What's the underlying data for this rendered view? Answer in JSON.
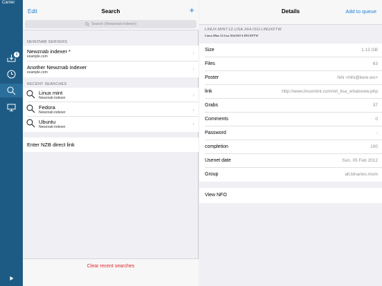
{
  "status_bar": {
    "carrier": "Carrier"
  },
  "sidebar": {
    "download_badge": "1",
    "items": [
      {
        "icon": "download-icon"
      },
      {
        "icon": "clock-icon"
      },
      {
        "icon": "search-icon"
      },
      {
        "icon": "monitor-icon"
      },
      {
        "icon": "play-icon"
      }
    ]
  },
  "middle": {
    "edit_label": "Edit",
    "title": "Search",
    "add_label": "+",
    "search_placeholder": "Search (Newznab indexer)",
    "servers_header": "NEWZNAB SERVERS",
    "servers": [
      {
        "name": "Newznab indexer *",
        "host": "example.com"
      },
      {
        "name": "Another Newznab indexer",
        "host": "example.com"
      }
    ],
    "recent_header": "RECENT SEARCHES",
    "recent": [
      {
        "query": "Linux mint",
        "indexer": "Newznab indexer"
      },
      {
        "query": "Fedora",
        "indexer": "Newznab indexer"
      },
      {
        "query": "Ubuntu",
        "indexer": "Newznab indexer"
      }
    ],
    "direct_link_label": "Enter NZB direct link",
    "clear_label": "Clear recent searches"
  },
  "details": {
    "title": "Details",
    "add_to_queue": "Add to queue",
    "filename": "LINUX.MINT.12.LISA.X64.ISO-LINUXFTW",
    "subname": "Linux.Mint.12.Lisa.X64.ISO-LINUXFTW",
    "rows": [
      {
        "label": "Size",
        "value": "1.13 GB"
      },
      {
        "label": "Files",
        "value": "63"
      },
      {
        "label": "Poster",
        "value": "hihi <hihi@kere.ws>"
      },
      {
        "label": "link",
        "value": "http://www.linuxmint.com/rel_lisa_whatsnew.php"
      },
      {
        "label": "Grabs",
        "value": "37"
      },
      {
        "label": "Comments",
        "value": "0"
      },
      {
        "label": "Password",
        "value": "-"
      },
      {
        "label": "completion",
        "value": "100"
      },
      {
        "label": "Usenet date",
        "value": "Sun, 05 Feb 2012"
      },
      {
        "label": "Group",
        "value": "alt.binaries.mom"
      }
    ],
    "view_nfo_label": "View NFO"
  },
  "colors": {
    "sidebar": "#1e5b84",
    "accent": "#1a7fd4",
    "destructive": "#e1262d"
  }
}
